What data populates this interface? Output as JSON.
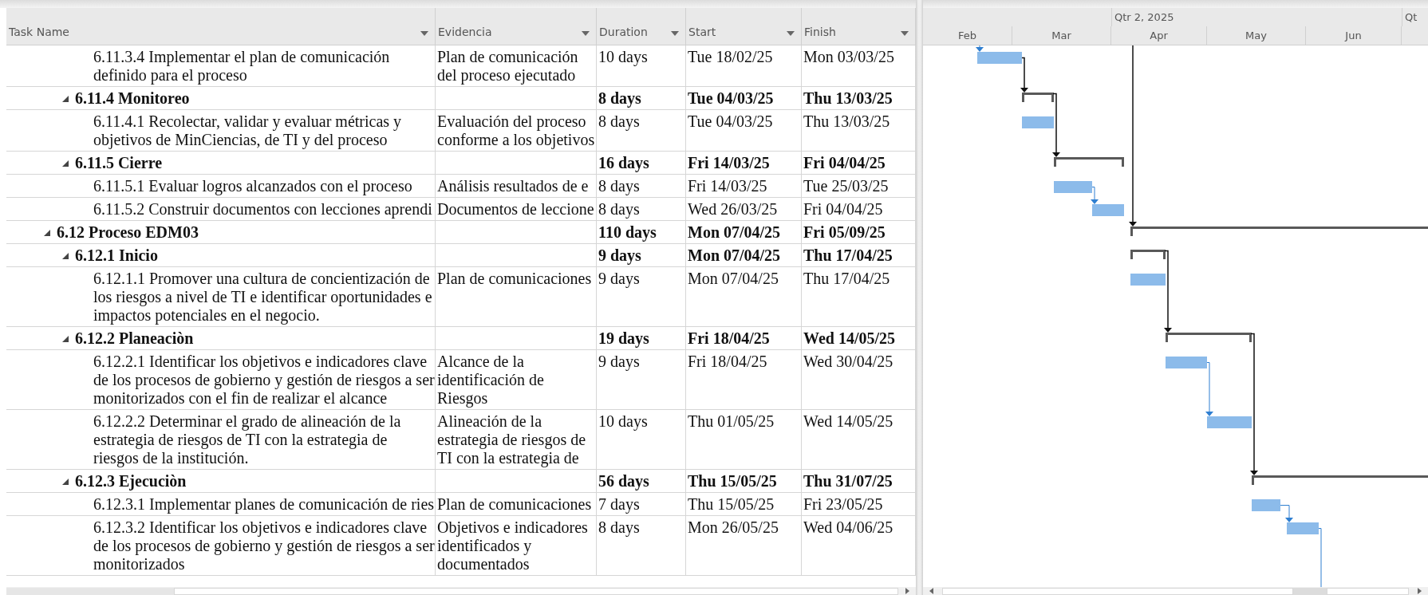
{
  "table": {
    "columns": [
      {
        "label": "Task Name"
      },
      {
        "label": "Evidencia"
      },
      {
        "label": "Duration"
      },
      {
        "label": "Start"
      },
      {
        "label": "Finish"
      }
    ],
    "rows": [
      {
        "children": [
          {
            "children": [
              {
                "kind": "task",
                "name": "6.11.3.4 Implementar el plan de comunicación definido para el proceso",
                "evidencia": "Plan de comunicación del proceso ejecutado",
                "duration": "10 days",
                "start": "Tue 18/02/25",
                "finish": "Mon 03/03/25",
                "link_from_top": true
              }
            ]
          },
          {
            "kind": "summary",
            "expanded": true,
            "name": "6.11.4 Monitoreo",
            "duration": "8 days",
            "start": "Tue 04/03/25",
            "finish": "Thu 13/03/25",
            "link_from_previous": true,
            "children": [
              {
                "kind": "task",
                "name": "6.11.4.1 Recolectar, validar y evaluar métricas y objetivos de MinCiencias, de TI y del proceso",
                "evidencia": "Evaluación del proceso conforme a los objetivos",
                "duration": "8 days",
                "start": "Tue 04/03/25",
                "finish": "Thu 13/03/25"
              }
            ]
          },
          {
            "kind": "summary",
            "expanded": true,
            "name": "6.11.5 Cierre",
            "duration": "16 days",
            "start": "Fri 14/03/25",
            "finish": "Fri 04/04/25",
            "link_from_sibling": true,
            "children": [
              {
                "kind": "task",
                "name": "6.11.5.1 Evaluar logros alcanzados con el proceso",
                "evidencia": "Análisis resultados de e",
                "duration": "8 days",
                "start": "Fri 14/03/25",
                "finish": "Tue 25/03/25"
              },
              {
                "kind": "task",
                "name": "6.11.5.2 Construir documentos con lecciones aprendi",
                "evidencia": "Documentos de leccione",
                "duration": "8 days",
                "start": "Wed 26/03/25",
                "finish": "Fri 04/04/25",
                "link_from_previous": true
              }
            ]
          }
        ]
      },
      {
        "kind": "summary",
        "expanded": true,
        "name": "6.12 Proceso EDM03",
        "duration": "110 days",
        "start": "Mon 07/04/25",
        "finish": "Fri 05/09/25",
        "link_from_top": true,
        "children": [
          {
            "kind": "summary",
            "expanded": true,
            "name": "6.12.1 Inicio",
            "duration": "9 days",
            "start": "Mon 07/04/25",
            "finish": "Thu 17/04/25",
            "children": [
              {
                "kind": "task",
                "name": "6.12.1.1 Promover una cultura de concientización de los riesgos a nivel de TI e identificar oportunidades e impactos potenciales en el negocio.",
                "evidencia": "Plan de comunicaciones",
                "duration": "9 days",
                "start": "Mon 07/04/25",
                "finish": "Thu 17/04/25"
              }
            ]
          },
          {
            "kind": "summary",
            "expanded": true,
            "name": "6.12.2 Planeaciòn",
            "duration": "19 days",
            "start": "Fri 18/04/25",
            "finish": "Wed 14/05/25",
            "link_from_sibling": true,
            "children": [
              {
                "kind": "task",
                "name": "6.12.2.1 Identificar los objetivos e indicadores clave de los procesos de gobierno y gestión de riesgos a ser monitorizados con el fin de realizar el alcance",
                "evidencia": "Alcance de la identificación de Riesgos",
                "duration": "9 days",
                "start": "Fri 18/04/25",
                "finish": "Wed 30/04/25"
              },
              {
                "kind": "task",
                "name": "6.12.2.2 Determinar el grado de alineación de la estrategia de riesgos de TI con la estrategia de riesgos de la institución.",
                "evidencia": "Alineación de la estrategia de riesgos de TI con la estrategia de",
                "duration": "10 days",
                "start": "Thu 01/05/25",
                "finish": "Wed 14/05/25",
                "link_from_previous": true
              }
            ]
          },
          {
            "kind": "summary",
            "expanded": true,
            "name": "6.12.3 Ejecuciòn",
            "duration": "56 days",
            "start": "Thu 15/05/25",
            "finish": "Thu 31/07/25",
            "link_from_sibling": true,
            "children": [
              {
                "kind": "task",
                "name": "6.12.3.1 Implementar planes de comunicación de ries",
                "evidencia": "Plan de comunicaciones",
                "duration": "7 days",
                "start": "Thu 15/05/25",
                "finish": "Fri 23/05/25"
              },
              {
                "kind": "task",
                "name": "6.12.3.2 Identificar los objetivos e indicadores clave de los procesos de gobierno y gestión de riesgos a ser monitorizados",
                "evidencia": "Objetivos e indicadores identificados y documentados",
                "duration": "8 days",
                "start": "Mon 26/05/25",
                "finish": "Wed 04/06/25",
                "link_from_previous": true,
                "link_out": true
              }
            ]
          }
        ]
      }
    ]
  },
  "gantt": {
    "quarters": [
      "Qtr 2, 2025",
      "Qt"
    ],
    "months": [
      "Feb",
      "Mar",
      "Apr",
      "May",
      "Jun"
    ]
  }
}
